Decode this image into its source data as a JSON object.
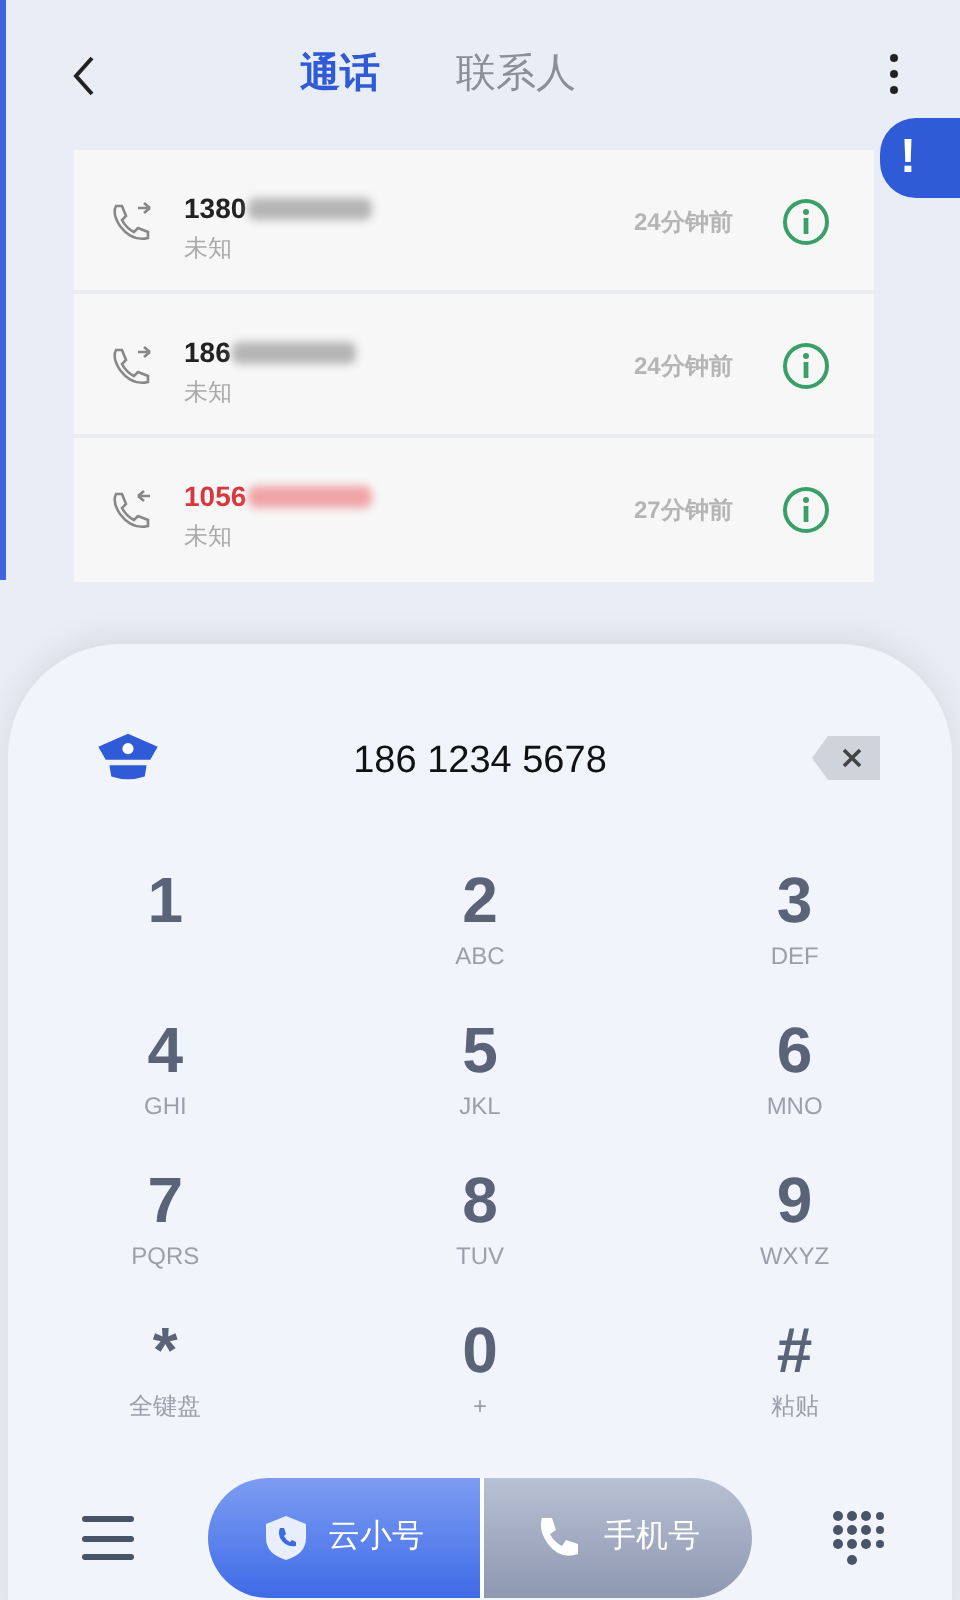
{
  "tabs": [
    {
      "label": "通话",
      "selected": true
    },
    {
      "label": "联系人",
      "selected": false
    }
  ],
  "calls": [
    {
      "number": "1380",
      "name": "未知",
      "time": "24分钟前",
      "kind": "outgoing",
      "missed": false
    },
    {
      "number": "186",
      "name": "未知",
      "time": "24分钟前",
      "kind": "outgoing",
      "missed": false
    },
    {
      "number": "1056",
      "name": "未知",
      "time": "27分钟前",
      "kind": "incoming",
      "missed": true
    }
  ],
  "dialed_number": "186 1234 5678",
  "alert": {
    "text": "!"
  },
  "keys": [
    {
      "digit": "1"
    },
    {
      "digit": "2",
      "sub": "ABC"
    },
    {
      "digit": "3",
      "sub": "DEF"
    },
    {
      "digit": "4",
      "sub": "GHI"
    },
    {
      "digit": "5",
      "sub": "JKL"
    },
    {
      "digit": "6",
      "sub": "MNO"
    },
    {
      "digit": "7",
      "sub": "PQRS"
    },
    {
      "digit": "8",
      "sub": "TUV"
    },
    {
      "digit": "9",
      "sub": "WXYZ"
    },
    {
      "digit": "*",
      "sub": "全键盘"
    },
    {
      "digit": "0",
      "sub": "+"
    },
    {
      "digit": "#",
      "sub": "粘贴"
    }
  ],
  "call_buttons": [
    {
      "label": "云小号",
      "kind": "cloud"
    },
    {
      "label": "手机号",
      "kind": "phone"
    }
  ]
}
